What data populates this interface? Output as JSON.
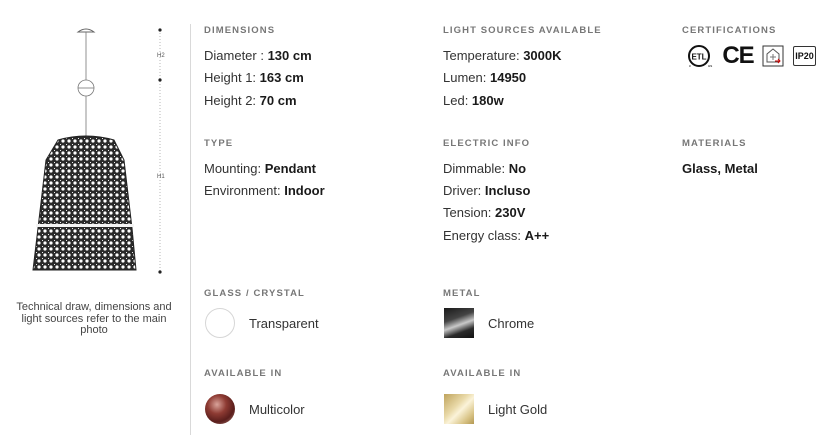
{
  "left": {
    "caption": "Technical draw, dimensions and light sources refer to the main photo",
    "dim_labels": {
      "h2": "H2",
      "h1": "H1"
    }
  },
  "dimensions": {
    "title": "DIMENSIONS",
    "rows": [
      {
        "label": "Diameter : ",
        "value": "130 cm"
      },
      {
        "label": "Height 1: ",
        "value": "163 cm"
      },
      {
        "label": "Height 2: ",
        "value": "70 cm"
      }
    ]
  },
  "light": {
    "title": "LIGHT SOURCES AVAILABLE",
    "rows": [
      {
        "label": "Temperature: ",
        "value": "3000K"
      },
      {
        "label": "Lumen: ",
        "value": "14950"
      },
      {
        "label": "Led: ",
        "value": "180w"
      }
    ]
  },
  "certifications": {
    "title": "CERTIFICATIONS",
    "ip": "IP20",
    "ce": "CE",
    "etl": "ETL"
  },
  "type": {
    "title": "TYPE",
    "rows": [
      {
        "label": "Mounting: ",
        "value": "Pendant"
      },
      {
        "label": "Environment: ",
        "value": "Indoor"
      }
    ]
  },
  "electric": {
    "title": "ELECTRIC INFO",
    "rows": [
      {
        "label": "Dimmable: ",
        "value": "No"
      },
      {
        "label": "Driver: ",
        "value": "Incluso"
      },
      {
        "label": "Tension: ",
        "value": "230V"
      },
      {
        "label": "Energy class: ",
        "value": "A++"
      }
    ]
  },
  "materials": {
    "title": "MATERIALS",
    "value": "Glass, Metal"
  },
  "glass": {
    "title": "GLASS / CRYSTAL",
    "option": "Transparent",
    "available_title": "AVAILABLE IN",
    "available_option": "Multicolor"
  },
  "metal": {
    "title": "METAL",
    "option": "Chrome",
    "available_title": "AVAILABLE IN",
    "available_option": "Light Gold"
  },
  "colors": {
    "accent_text": "#1a1a1a",
    "label_text": "#777777",
    "divider": "#d9d9d9",
    "gold": "#d9c487"
  }
}
